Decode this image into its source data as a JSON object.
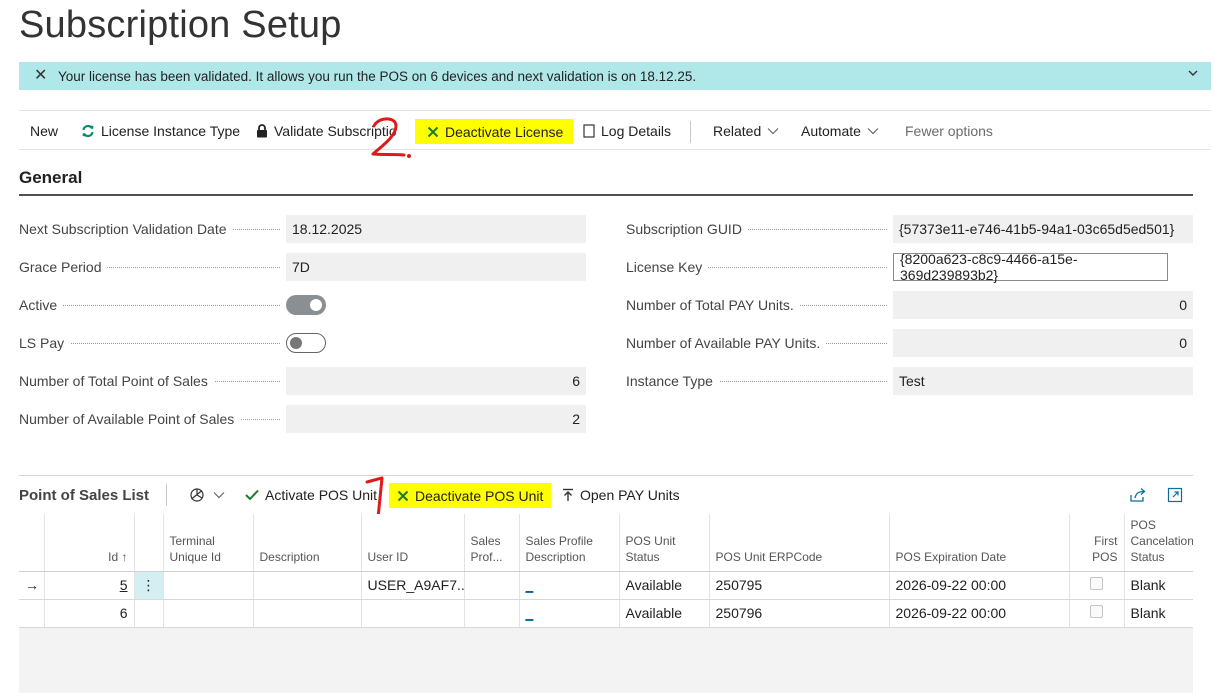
{
  "page": {
    "title": "Subscription Setup"
  },
  "notification": {
    "text": "Your license has been validated. It allows you run the POS on 6 devices and next validation is on 18.12.25."
  },
  "toolbar": {
    "new": "New",
    "license_instance_type": "License Instance Type",
    "validate_subscription": "Validate Subscriptio",
    "deactivate_license": "Deactivate License",
    "log_details": "Log Details",
    "related": "Related",
    "automate": "Automate",
    "fewer_options": "Fewer options"
  },
  "annotations": {
    "one": "1.",
    "two": "2."
  },
  "general": {
    "heading": "General",
    "next_validation_date": {
      "label": "Next Subscription Validation Date",
      "value": "18.12.2025"
    },
    "grace_period": {
      "label": "Grace Period",
      "value": "7D"
    },
    "active": {
      "label": "Active",
      "checked": true
    },
    "ls_pay": {
      "label": "LS Pay",
      "checked": false
    },
    "total_pos": {
      "label": "Number of Total Point of Sales",
      "value": "6"
    },
    "available_pos": {
      "label": "Number of Available Point of Sales",
      "value": "2"
    },
    "subscription_guid": {
      "label": "Subscription GUID",
      "value": "{57373e11-e746-41b5-94a1-03c65d5ed501}"
    },
    "license_key": {
      "label": "License Key",
      "value": "{8200a623-c8c9-4466-a15e-369d239893b2}"
    },
    "total_pay_units": {
      "label": "Number of Total PAY Units.",
      "value": "0"
    },
    "available_pay_units": {
      "label": "Number of Available PAY Units.",
      "value": "0"
    },
    "instance_type": {
      "label": "Instance Type",
      "value": "Test"
    }
  },
  "pos_list": {
    "title": "Point of Sales List",
    "actions": {
      "activate": "Activate POS Unit",
      "deactivate": "Deactivate POS Unit",
      "open_pay": "Open PAY Units"
    },
    "columns": {
      "id": "Id ↑",
      "terminal_unique_id": "Terminal Unique Id",
      "description": "Description",
      "user_id": "User ID",
      "sales_prof": "Sales Prof...",
      "sales_profile_description": "Sales Profile Description",
      "pos_unit_status": "POS Unit Status",
      "pos_unit_erpcode": "POS Unit ERPCode",
      "pos_expiration_date": "POS Expiration Date",
      "first_pos": "First POS",
      "pos_cancelation_status": "POS Cancelation Status"
    },
    "rows": [
      {
        "marker": "→",
        "id": "5",
        "menu": "⋮",
        "terminal_unique_id": "",
        "description": "",
        "user_id": "USER_A9AF7...",
        "sales_prof": "",
        "sales_profile_description": "_",
        "pos_unit_status": "Available",
        "pos_unit_erpcode": "250795",
        "pos_expiration_date": "2026-09-22 00:00",
        "first_pos": false,
        "pos_cancelation_status": "Blank"
      },
      {
        "marker": "",
        "id": "6",
        "menu": "",
        "terminal_unique_id": "",
        "description": "",
        "user_id": "",
        "sales_prof": "",
        "sales_profile_description": "_",
        "pos_unit_status": "Available",
        "pos_unit_erpcode": "250796",
        "pos_expiration_date": "2026-09-22 00:00",
        "first_pos": false,
        "pos_cancelation_status": "Blank"
      }
    ]
  },
  "colors": {
    "notification_bg": "#b0e8ea",
    "highlight": "#ffff00",
    "accent": "#00669b",
    "annotation_red": "#e0191b"
  }
}
